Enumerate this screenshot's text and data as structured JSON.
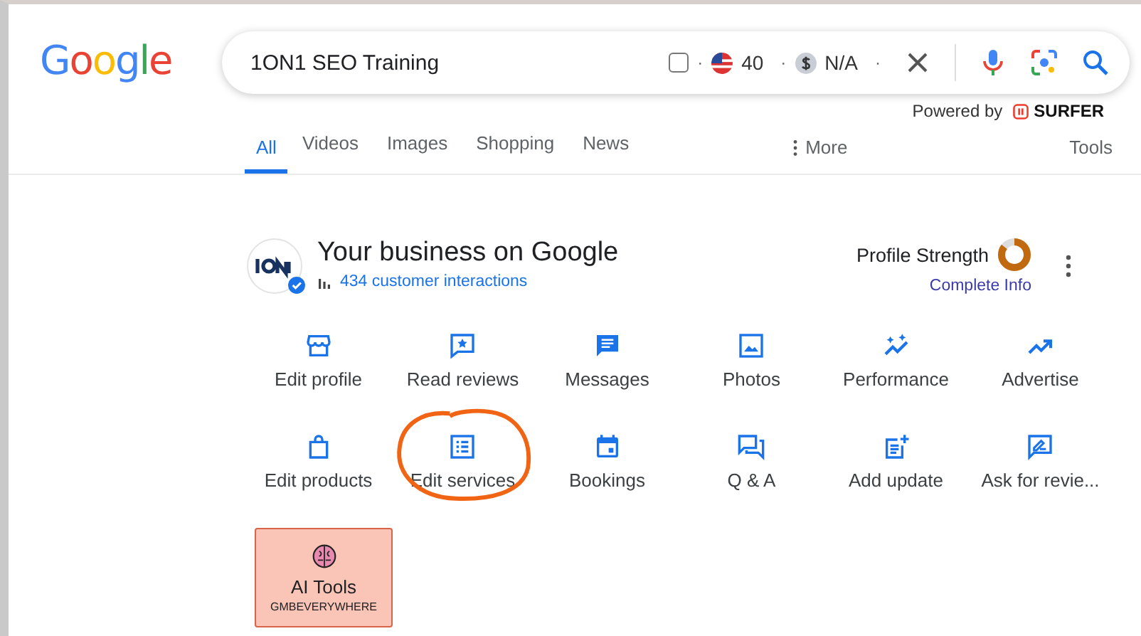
{
  "logo": "Google",
  "search": {
    "query": "1ON1 SEO Training",
    "checked": false,
    "country_count": "40",
    "cost": "N/A",
    "separator": "·"
  },
  "powered_by": {
    "text": "Powered by",
    "brand": "SURFER"
  },
  "tabs": [
    {
      "label": "All",
      "selected": true
    },
    {
      "label": "Videos",
      "selected": false
    },
    {
      "label": "Images",
      "selected": false
    },
    {
      "label": "Shopping",
      "selected": false
    },
    {
      "label": "News",
      "selected": false
    }
  ],
  "more": "More",
  "tools": "Tools",
  "business": {
    "title": "Your business on Google",
    "interactions": "434 customer interactions",
    "profile_strength": "Profile Strength",
    "level": 0.85,
    "complete_info": "Complete Info"
  },
  "actions": [
    {
      "kind": "store",
      "label": "Edit profile"
    },
    {
      "kind": "review",
      "label": "Read reviews"
    },
    {
      "kind": "message",
      "label": "Messages"
    },
    {
      "kind": "photo",
      "label": "Photos"
    },
    {
      "kind": "performance",
      "label": "Performance"
    },
    {
      "kind": "advertise",
      "label": "Advertise"
    },
    {
      "kind": "bag",
      "label": "Edit products"
    },
    {
      "kind": "list",
      "label": "Edit services",
      "circled": true
    },
    {
      "kind": "calendar",
      "label": "Bookings"
    },
    {
      "kind": "qa",
      "label": "Q & A"
    },
    {
      "kind": "post",
      "label": "Add update"
    },
    {
      "kind": "ask",
      "label": "Ask for revie..."
    }
  ],
  "ai_tools": {
    "label": "AI Tools",
    "sub": "GMBEVERYWHERE"
  }
}
